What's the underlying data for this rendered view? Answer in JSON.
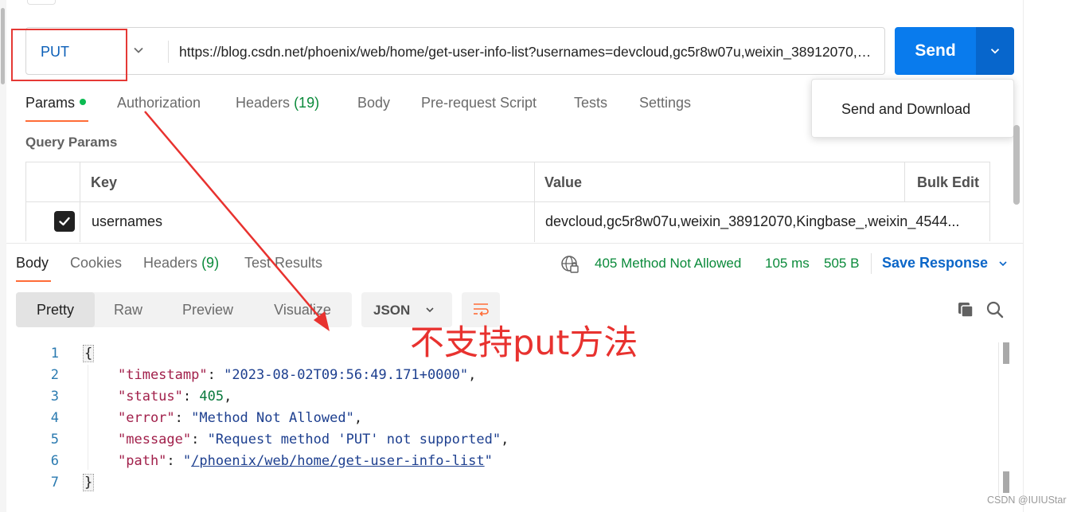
{
  "request": {
    "method": "PUT",
    "url": "https://blog.csdn.net/phoenix/web/home/get-user-info-list?usernames=devcloud,gc5r8w07u,weixin_38912070,Kingbase_,weixin_4544",
    "send_label": "Send",
    "send_menu": [
      "Send and Download"
    ]
  },
  "request_tabs": {
    "params": "Params",
    "authorization": "Authorization",
    "headers": "Headers",
    "headers_count": "(19)",
    "body": "Body",
    "pre_request": "Pre-request Script",
    "tests": "Tests",
    "settings": "Settings"
  },
  "query_params": {
    "title": "Query Params",
    "columns": {
      "key": "Key",
      "value": "Value",
      "bulk_edit": "Bulk Edit"
    },
    "rows": [
      {
        "checked": true,
        "key": "usernames",
        "value": "devcloud,gc5r8w07u,weixin_38912070,Kingbase_,weixin_4544..."
      }
    ]
  },
  "response_tabs": {
    "body": "Body",
    "cookies": "Cookies",
    "headers": "Headers",
    "headers_count": "(9)",
    "test_results": "Test Results"
  },
  "response_status": {
    "status": "405 Method Not Allowed",
    "time": "105 ms",
    "size": "505 B",
    "save_label": "Save Response"
  },
  "view_modes": [
    "Pretty",
    "Raw",
    "Preview",
    "Visualize"
  ],
  "format": "JSON",
  "code_lines": {
    "l1": "1",
    "l2": "2",
    "l3": "3",
    "l4": "4",
    "l5": "5",
    "l6": "6",
    "l7": "7",
    "open_brace": "{",
    "close_brace": "}",
    "timestamp_key": "\"timestamp\"",
    "timestamp_val": "\"2023-08-02T09:56:49.171+0000\"",
    "status_key": "\"status\"",
    "status_val": "405",
    "error_key": "\"error\"",
    "error_val": "\"Method Not Allowed\"",
    "message_key": "\"message\"",
    "message_val": "\"Request method 'PUT' not supported\"",
    "path_key": "\"path\"",
    "path_quote": "\"",
    "path_val": "/phoenix/web/home/get-user-info-list"
  },
  "annotation": "不支持put方法",
  "watermark": "CSDN @IUIUStar",
  "colors": {
    "send_blue": "#097bed",
    "method_blue": "#0b5fb8",
    "status_green": "#0a8a3a",
    "active_tab_orange": "#ff6c37",
    "annotation_red": "#e8322f"
  }
}
